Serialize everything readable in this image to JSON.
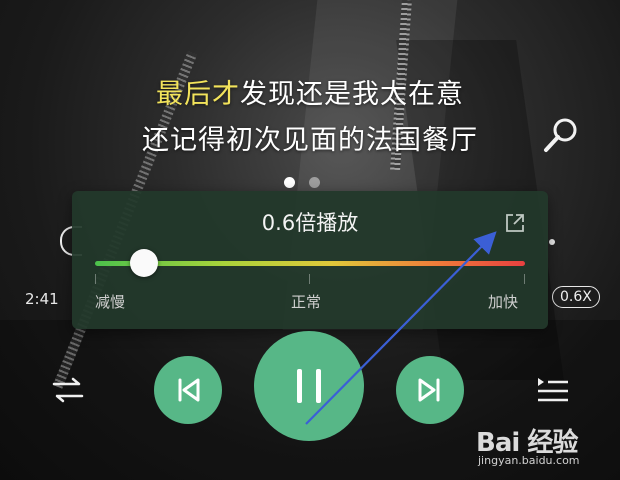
{
  "lyrics": {
    "line1_highlight": "最后才",
    "line1_rest": "发现还是我太在意",
    "line2": "还记得初次见面的法国餐厅"
  },
  "pager": {
    "count": 2,
    "active_index": 0
  },
  "speed_popup": {
    "title": "0.6倍播放",
    "slider_value": 0.6,
    "slow_label": "减慢",
    "normal_label": "正常",
    "fast_label": "加快"
  },
  "player": {
    "elapsed_time": "2:41",
    "speed_badge": "0.6X"
  },
  "watermark": {
    "brand": "Bai 经验",
    "url": "jingyan.baidu.com"
  },
  "colors": {
    "lyric_highlight": "#f2e35b",
    "control_green": "#57b787",
    "popup_bg": "#22382a",
    "annotation_arrow": "#3b5fd6"
  },
  "icons": {
    "mic": "microphone-icon",
    "share": "share-external-icon",
    "prev": "skip-previous-icon",
    "pause": "pause-icon",
    "next": "skip-next-icon",
    "mode": "shuffle-icon",
    "playlist": "playlist-icon"
  }
}
